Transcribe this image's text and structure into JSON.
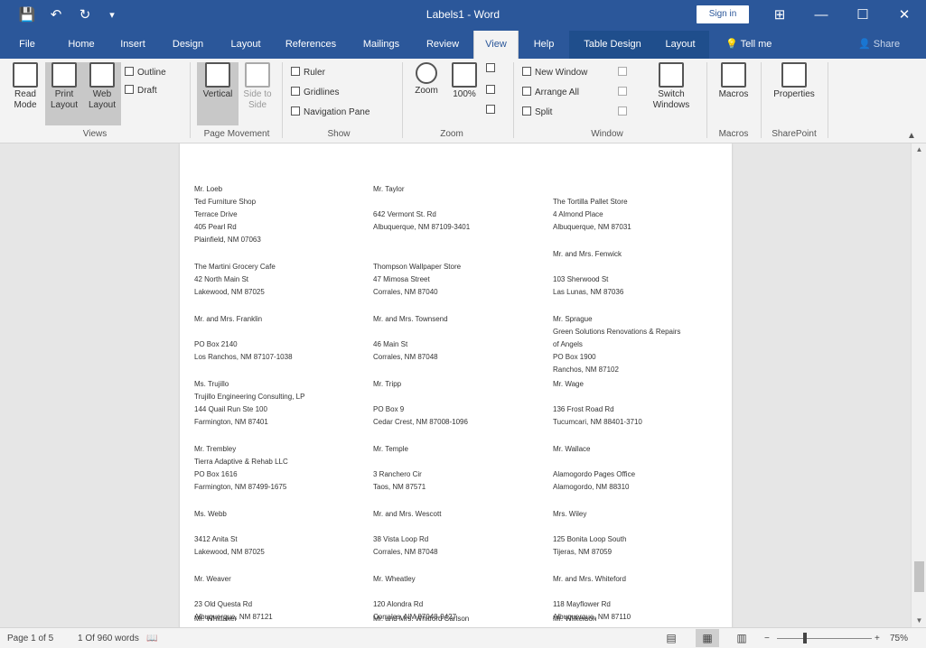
{
  "titlebar": {
    "title": "Labels1 - Word",
    "signin": "Sign in",
    "icons": {
      "save": "💾",
      "undo": "↶",
      "redo": "↻",
      "customize": "▾"
    },
    "window_controls": {
      "ribbon_options": "⊞",
      "minimize": "—",
      "maximize": "☐",
      "close": "✕"
    }
  },
  "tabs": [
    "File",
    "Home",
    "Insert",
    "Design",
    "Layout",
    "References",
    "Mailings",
    "Review",
    "View",
    "Help",
    "Table Design",
    "Layout"
  ],
  "active_tab": "View",
  "tellme": "Tell me",
  "share": "Share",
  "ribbon": {
    "views": {
      "read_mode": "Read Mode",
      "print_layout": "Print Layout",
      "web_layout": "Web Layout",
      "outline": "Outline",
      "draft": "Draft",
      "label": "Views"
    },
    "page_movement": {
      "vertical": "Vertical",
      "side_to_side": "Side to Side",
      "label": "Page Movement"
    },
    "show": {
      "ruler": "Ruler",
      "gridlines": "Gridlines",
      "navigation_pane": "Navigation Pane",
      "label": "Show"
    },
    "zoom": {
      "zoom": "Zoom",
      "hundred": "100%",
      "label": "Zoom"
    },
    "window": {
      "new_window": "New Window",
      "arrange_all": "Arrange All",
      "split": "Split",
      "switch_windows": "Switch Windows",
      "label": "Window"
    },
    "macros": {
      "macros": "Macros",
      "label": "Macros"
    },
    "sharepoint": {
      "properties": "Properties",
      "label": "SharePoint"
    }
  },
  "labels": [
    [
      "Mr. Loeb",
      "Ted Furniture Shop",
      "Terrace Drive",
      "405 Pearl Rd",
      "Plainfield, NM 07063"
    ],
    [
      "Mr. Taylor",
      "",
      "642 Vermont St. Rd",
      "Albuquerque, NM 87109-3401"
    ],
    [
      "The Tortilla Pallet Store",
      "4 Almond Place",
      "Albuquerque, NM 87031"
    ],
    [
      "",
      "",
      "",
      "Mr. and Mrs. Fenwick"
    ],
    [
      "The Martini Grocery Cafe",
      "42 North Main St",
      "Lakewood, NM 87025"
    ],
    [
      "Thompson Wallpaper Store",
      "47 Mimosa Street",
      "Corrales, NM 87040"
    ],
    [
      "103 Sherwood St",
      "Las Lunas, NM 87036"
    ],
    [
      "Mr. and Mrs. Franklin",
      "",
      "PO Box 2140",
      "Los Ranchos, NM 87107-1038"
    ],
    [
      "Mr. and Mrs. Townsend",
      "",
      "46 Main St",
      "Corrales, NM 87048"
    ],
    [
      "Mr. Sprague",
      "Green Solutions Renovations & Repairs",
      "of Angels",
      "PO Box 1900",
      "Ranchos, NM 87102"
    ],
    [
      "Ms. Trujillo",
      "Trujillo Engineering Consulting, LP",
      "144 Quail Run Ste 100",
      "Farmington, NM 87401"
    ],
    [
      "Mr. Tripp",
      "",
      "PO Box 9",
      "Cedar Crest, NM 87008-1096"
    ],
    [
      "Mr. Wage",
      "",
      "136 Frost Road Rd",
      "Tucumcari, NM 88401-3710"
    ],
    [
      "Mr. Trembley",
      "Tierra Adaptive & Rehab LLC",
      "PO Box 1616",
      "Farmington, NM 87499-1675"
    ],
    [
      "Mr. Temple",
      "",
      "3 Ranchero Cir",
      "Taos, NM 87571"
    ],
    [
      "Mr. Wallace",
      "",
      "Alamogordo Pages Office",
      "Alamogordo, NM 88310"
    ],
    [
      "Ms. Webb",
      "",
      "3412 Anita St",
      "Lakewood, NM 87025"
    ],
    [
      "Mr. and Mrs. Wescott",
      "",
      "38 Vista Loop Rd",
      "Corrales, NM 87048"
    ],
    [
      "Mrs. Wiley",
      "",
      "125 Bonita Loop South",
      "Tijeras, NM 87059"
    ],
    [
      "Mr. Weaver",
      "",
      "23 Old Questa Rd",
      "Albuquerque, NM 87121"
    ],
    [
      "Mr. Wheatley",
      "",
      "120 Alondra Rd",
      "Corrales, NM 87048-9427"
    ],
    [
      "Mr. and Mrs. Whiteford",
      "",
      "118 Mayflower Rd",
      "Albuquerque, NM 87110"
    ],
    [
      "Mr. Whittaker",
      "",
      "",
      ""
    ],
    [
      "Mr. and Mrs. Whitford Carlson",
      "",
      "",
      ""
    ],
    [
      "Mr. Wilkerson",
      "",
      "",
      ""
    ]
  ],
  "status": {
    "page": "Page 1 of 5",
    "words": "1 Of 960 words",
    "proofing_icon": "📖",
    "zoom": "75%",
    "view_icons": {
      "read": "▤",
      "print": "▦",
      "web": "▥"
    },
    "zoom_out": "−",
    "zoom_in": "+"
  }
}
